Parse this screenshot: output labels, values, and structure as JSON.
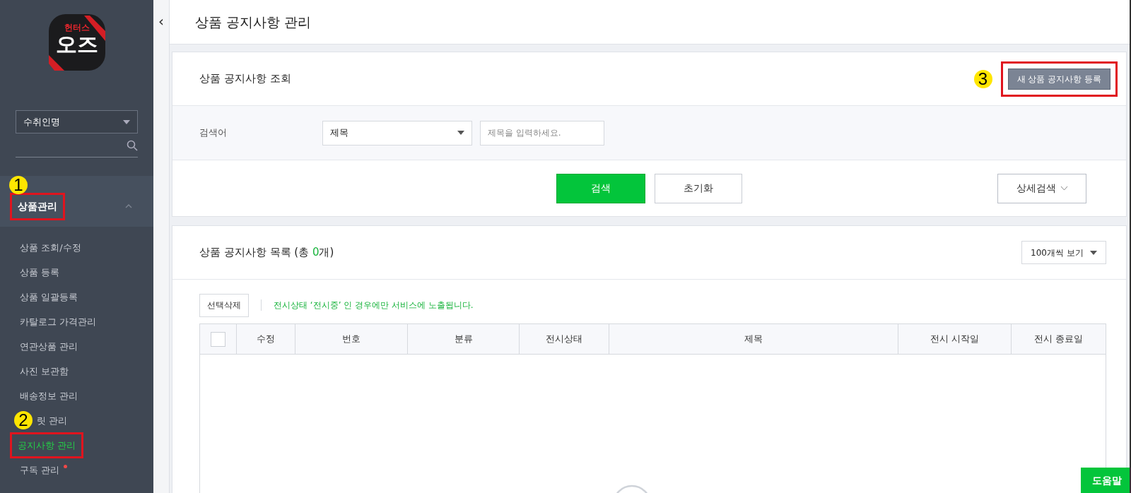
{
  "sidebar": {
    "logo": {
      "top": "헌터스",
      "main": "오즈"
    },
    "search": {
      "field": "수취인명"
    },
    "section": {
      "label": "상품관리",
      "expanded": true,
      "callout": "1"
    },
    "items": [
      {
        "label": "상품 조회/수정",
        "selected": false
      },
      {
        "label": "상품 등록",
        "selected": false
      },
      {
        "label": "상품 일괄등록",
        "selected": false
      },
      {
        "label": "카탈로그 가격관리",
        "selected": false
      },
      {
        "label": "연관상품 관리",
        "selected": false
      },
      {
        "label": "사진 보관함",
        "selected": false
      },
      {
        "label": "배송정보 관리",
        "selected": false
      },
      {
        "label": "릿 관리",
        "selected": false,
        "callout": "2"
      },
      {
        "label": "공지사항 관리",
        "selected": true,
        "framed": true
      },
      {
        "label": "구독 관리",
        "selected": false,
        "new": true
      }
    ]
  },
  "collapse": "‹",
  "page_title": "상품 공지사항 관리",
  "search_card": {
    "title": "상품 공지사항 조회",
    "new_button": {
      "label": "새 상품 공지사항 등록",
      "callout": "3"
    },
    "keyword_label": "검색어",
    "keyword_select": "제목",
    "keyword_placeholder": "제목을 입력하세요.",
    "search_button": "검색",
    "reset_button": "초기화",
    "detail_button": "상세검색"
  },
  "list_card": {
    "title": "상품 공지사항 목록 (총 ",
    "count": "0",
    "title_end": "개)",
    "page_size": "100개씩 보기",
    "delete_button": "선택삭제",
    "notice": "전시상태 ‘전시중’ 인 경우에만 서비스에 노출됩니다.",
    "table": {
      "select_all": false,
      "columns": [
        "수정",
        "번호",
        "분류",
        "전시상태",
        "제목",
        "전시 시작일",
        "전시 종료일"
      ]
    }
  },
  "help_button": "도움말"
}
